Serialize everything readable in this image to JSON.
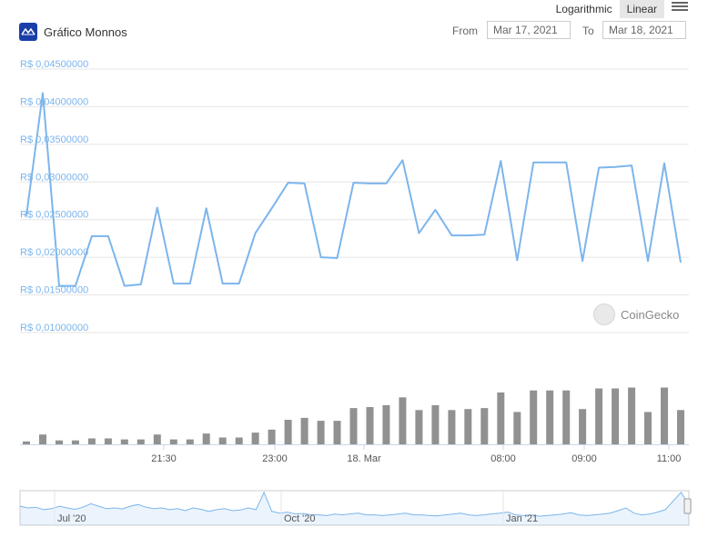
{
  "header": {
    "scale_options": [
      "Logarithmic",
      "Linear"
    ],
    "active_scale": "Linear",
    "brand_name": "Gráfico Monnos",
    "from_label": "From",
    "from_value": "Mar 17, 2021",
    "to_label": "To",
    "to_value": "Mar 18, 2021",
    "accent_color": "#7cb5ec",
    "brand_color": "#1a3fa8"
  },
  "watermark": {
    "text": "CoinGecko"
  },
  "chart_data": [
    {
      "type": "line",
      "y_axis": {
        "ticks": [
          0.045,
          0.04,
          0.035,
          0.03,
          0.025,
          0.02,
          0.015,
          0.01
        ],
        "tick_labels": [
          "R$ 0,04500000",
          "R$ 0,04000000",
          "R$ 0,03500000",
          "R$ 0,03000000",
          "R$ 0,02500000",
          "R$ 0,02000000",
          "R$ 0,01500000",
          "R$ 0,01000000"
        ],
        "ylim": [
          0.01,
          0.045
        ]
      },
      "x_axis": {
        "tick_labels": [
          "21:30",
          "23:00",
          "18. Mar",
          "08:00",
          "09:00",
          "11:00"
        ]
      },
      "grid": true,
      "color": "#7cb5ec",
      "values": [
        0.0255,
        0.0418,
        0.0162,
        0.0162,
        0.0228,
        0.0228,
        0.0162,
        0.0164,
        0.0266,
        0.0165,
        0.0165,
        0.0265,
        0.0165,
        0.0165,
        0.0232,
        0.0265,
        0.0299,
        0.0298,
        0.02,
        0.0199,
        0.0299,
        0.0298,
        0.0298,
        0.0329,
        0.0232,
        0.0263,
        0.0229,
        0.0229,
        0.023,
        0.0328,
        0.0196,
        0.0326,
        0.0326,
        0.0326,
        0.0195,
        0.0319,
        0.032,
        0.0322,
        0.0195,
        0.0325,
        0.0193
      ]
    },
    {
      "type": "bar",
      "series": [
        {
          "values": [
            3,
            10,
            4,
            4,
            6,
            6,
            5,
            5,
            10,
            5,
            5,
            11,
            7,
            7,
            12,
            15,
            25,
            27,
            24,
            24,
            37,
            38,
            40,
            48,
            35,
            40,
            35,
            36,
            37,
            53,
            33,
            55,
            55,
            55,
            36,
            57,
            57,
            58,
            33,
            58,
            35
          ]
        }
      ],
      "color": "#919191",
      "ylim": [
        0,
        64
      ]
    },
    {
      "type": "area",
      "x_axis": {
        "tick_labels": [
          "Jul '20",
          "Oct '20",
          "Jan '21"
        ]
      },
      "values": [
        0.55,
        0.5,
        0.52,
        0.45,
        0.48,
        0.55,
        0.5,
        0.46,
        0.52,
        0.62,
        0.55,
        0.48,
        0.5,
        0.47,
        0.55,
        0.6,
        0.52,
        0.48,
        0.5,
        0.45,
        0.48,
        0.42,
        0.5,
        0.46,
        0.4,
        0.45,
        0.48,
        0.42,
        0.44,
        0.5,
        0.45,
        0.95,
        0.4,
        0.35,
        0.38,
        0.32,
        0.34,
        0.3,
        0.3,
        0.28,
        0.32,
        0.3,
        0.33,
        0.35,
        0.3,
        0.3,
        0.28,
        0.3,
        0.32,
        0.35,
        0.3,
        0.3,
        0.28,
        0.27,
        0.3,
        0.32,
        0.35,
        0.3,
        0.28,
        0.3,
        0.33,
        0.35,
        0.38,
        0.3,
        0.28,
        0.3,
        0.26,
        0.28,
        0.3,
        0.32,
        0.36,
        0.3,
        0.28,
        0.3,
        0.32,
        0.35,
        0.42,
        0.5,
        0.35,
        0.3,
        0.32,
        0.38,
        0.45,
        0.7,
        0.95,
        0.6
      ]
    }
  ]
}
